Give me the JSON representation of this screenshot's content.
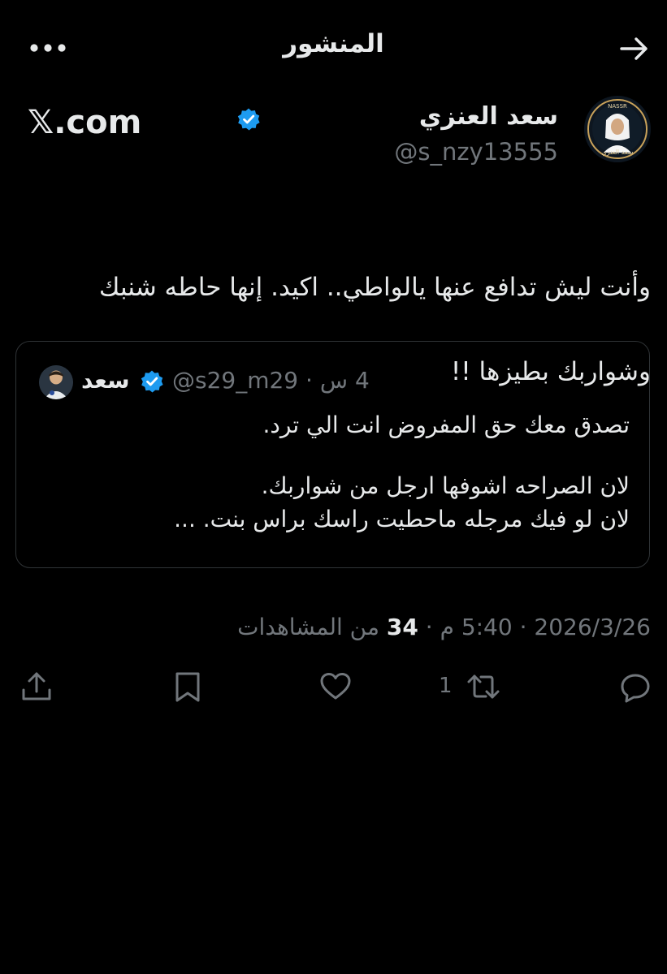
{
  "header": {
    "title": "المنشور",
    "back_icon": "arrow-right-icon",
    "more_icon": "more-dots-icon"
  },
  "author": {
    "name": "سعد العنزي",
    "handle": "@s_nzy13555",
    "verified": true,
    "avatar_badge_text": "NASSR",
    "avatar_caption": "سعد العنزي"
  },
  "watermark": "𝕏.com",
  "tweet": {
    "text_line1": "وأنت ليش تدافع عنها  يالواطي.. اكيد. إنها حاطه شنبك",
    "text_line2": "وشواربك بطيزها !!"
  },
  "quote": {
    "name": "سعد",
    "handle": "@s29_m29",
    "separator": "·",
    "time": "4 س",
    "line1": "تصدق معك حق المفروض انت الي ترد.",
    "line2": "لان الصراحه اشوفها ارجل من شواربك.",
    "line3": "لان لو فيك مرجله ماحطيت راسك براس بنت. ..."
  },
  "stamp": {
    "time": "5:40 م",
    "date": "2026/3/26",
    "views_count": "34",
    "views_label": "من المشاهدات",
    "separator": "·"
  },
  "actions": {
    "reply_icon": "reply-icon",
    "retweet_icon": "retweet-icon",
    "retweet_count": "1",
    "like_icon": "heart-icon",
    "bookmark_icon": "bookmark-icon",
    "share_icon": "share-icon"
  },
  "colors": {
    "background": "#000000",
    "text": "#e7e9ea",
    "muted": "#71767b",
    "verified": "#1d9bf0",
    "border": "#2f3336"
  }
}
